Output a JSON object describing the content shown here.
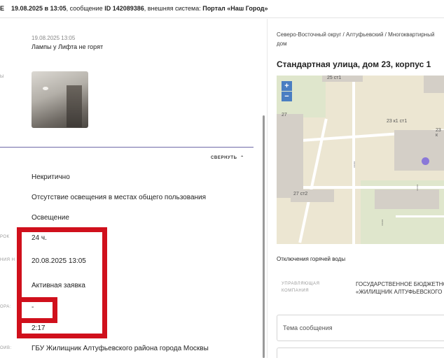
{
  "topbar": {
    "cut_left": "Е",
    "datetime": "19.08.2025 в 13:05",
    "message_prefix": ", сообщение ",
    "message_id": "ID 142089386",
    "external_prefix": ", внешняя система: ",
    "external_system": "Портал «Наш Город»"
  },
  "message": {
    "time": "19.08.2025 13:05",
    "text": "Лампы у Лифта не горят",
    "photo_label_cut": "Ы"
  },
  "details": {
    "collapse_label": "СВЕРНУТЬ",
    "collapse_icon": "chevron-up-icon",
    "fields": [
      {
        "label_cut": "",
        "value": "Некритично"
      },
      {
        "label_cut": "",
        "value": "Отсутствие освещения в местах общего пользования"
      },
      {
        "label_cut": "",
        "value": "Освещение"
      },
      {
        "label_cut": "РОК",
        "value": "24 ч."
      },
      {
        "label_cut": "НИЯ Н",
        "value": "20.08.2025 13:05"
      },
      {
        "label_cut": "",
        "value": "Активная заявка"
      },
      {
        "label_cut": "ОРА:",
        "value": "-"
      },
      {
        "label_cut": "",
        "value": "2:17"
      },
      {
        "label_cut": "ОИВ:",
        "value": "ГБУ Жилищник Алтуфьевского района города Москвы"
      }
    ]
  },
  "highlight_color": "#d0101c",
  "address_panel": {
    "breadcrumbs": "Северо-Восточный округ / Алтуфьевский / Многоквартирный дом",
    "address": "Стандартная улица, дом 23, корпус 1"
  },
  "map": {
    "zoom_in": "+",
    "zoom_out": "−",
    "labels": [
      "25 ст1",
      "27",
      "23 к1 ст1",
      "23 к",
      "27 ст2"
    ],
    "marker_color": "#8a78d8"
  },
  "hot_water": {
    "title": "Отключения горячей воды"
  },
  "management": {
    "label_line1": "УПРАВЛЯЮЩАЯ",
    "label_line2": "КОМПАНИЯ",
    "value_line1": "ГОСУДАРСТВЕННОЕ БЮДЖЕТНО",
    "value_line2": "«ЖИЛИЩНИК АЛТУФЬЕВСКОГО"
  },
  "form": {
    "topic_placeholder": "Тема сообщения"
  }
}
